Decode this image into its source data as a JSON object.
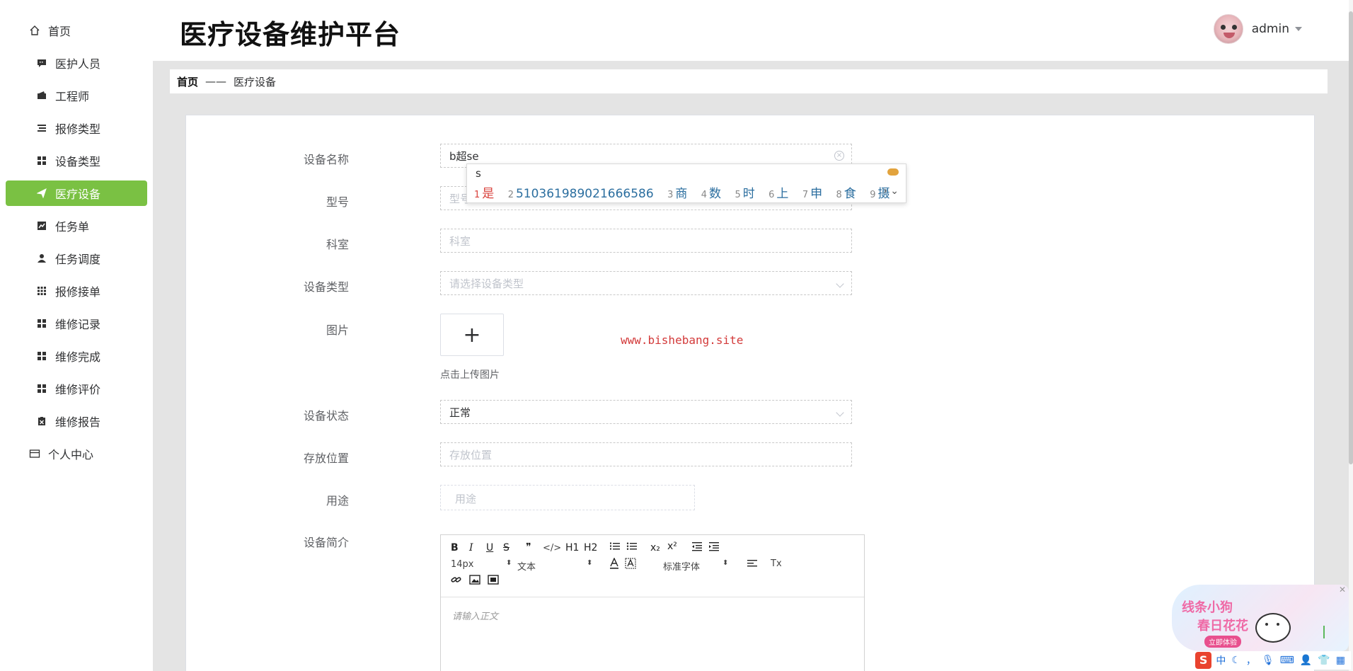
{
  "header": {
    "title": "医疗设备维护平台",
    "username": "admin"
  },
  "sidebar": {
    "items": [
      {
        "label": "首页",
        "icon": "home-icon"
      },
      {
        "label": "医护人员",
        "icon": "chat-icon"
      },
      {
        "label": "工程师",
        "icon": "wallet-icon"
      },
      {
        "label": "报修类型",
        "icon": "list-icon"
      },
      {
        "label": "设备类型",
        "icon": "grid-icon"
      },
      {
        "label": "医疗设备",
        "icon": "send-icon",
        "active": true
      },
      {
        "label": "任务单",
        "icon": "chart-icon"
      },
      {
        "label": "任务调度",
        "icon": "user-icon"
      },
      {
        "label": "报修接单",
        "icon": "apps-icon"
      },
      {
        "label": "维修记录",
        "icon": "grid-icon"
      },
      {
        "label": "维修完成",
        "icon": "grid-icon"
      },
      {
        "label": "维修评价",
        "icon": "grid-icon"
      },
      {
        "label": "维修报告",
        "icon": "clipboard-icon"
      },
      {
        "label": "个人中心",
        "icon": "card-icon"
      }
    ],
    "active_color": "#7ac143"
  },
  "breadcrumb": {
    "home": "首页",
    "separator": "——",
    "current": "医疗设备"
  },
  "form": {
    "device_name": {
      "label": "设备名称",
      "value": "b超se"
    },
    "model": {
      "label": "型号",
      "placeholder": "型号"
    },
    "department": {
      "label": "科室",
      "placeholder": "科室"
    },
    "device_type": {
      "label": "设备类型",
      "placeholder": "请选择设备类型"
    },
    "image": {
      "label": "图片",
      "upload_tip": "点击上传图片",
      "plus": "+"
    },
    "status": {
      "label": "设备状态",
      "value": "正常"
    },
    "location": {
      "label": "存放位置",
      "placeholder": "存放位置"
    },
    "usage": {
      "label": "用途",
      "placeholder": "用途"
    },
    "intro": {
      "label": "设备简介"
    }
  },
  "editor": {
    "font_size": "14px",
    "text_style": "文本",
    "font_family": "标准字体",
    "placeholder": "请输入正文",
    "h1": "H1",
    "h2": "H2",
    "sub": "x₂",
    "sup": "x²",
    "bold": "B",
    "italic": "I",
    "underline": "U",
    "strike": "S",
    "quote": "❞",
    "code": "</>",
    "clean": "Tx"
  },
  "watermark": "www.bishebang.site",
  "ime": {
    "composition": "s",
    "candidates": [
      {
        "n": "1",
        "text": "是"
      },
      {
        "n": "2",
        "text": "510361989021666586"
      },
      {
        "n": "3",
        "text": "商"
      },
      {
        "n": "4",
        "text": "数"
      },
      {
        "n": "5",
        "text": "时"
      },
      {
        "n": "6",
        "text": "上"
      },
      {
        "n": "7",
        "text": "申"
      },
      {
        "n": "8",
        "text": "食"
      },
      {
        "n": "9",
        "text": "摄"
      }
    ],
    "next": "›",
    "more": "⌄"
  },
  "ad": {
    "line1": "线条小狗",
    "line2": "春日花花",
    "button": "立即体验"
  },
  "imebar": {
    "logo": "S",
    "lang": "中",
    "punct": "，"
  }
}
